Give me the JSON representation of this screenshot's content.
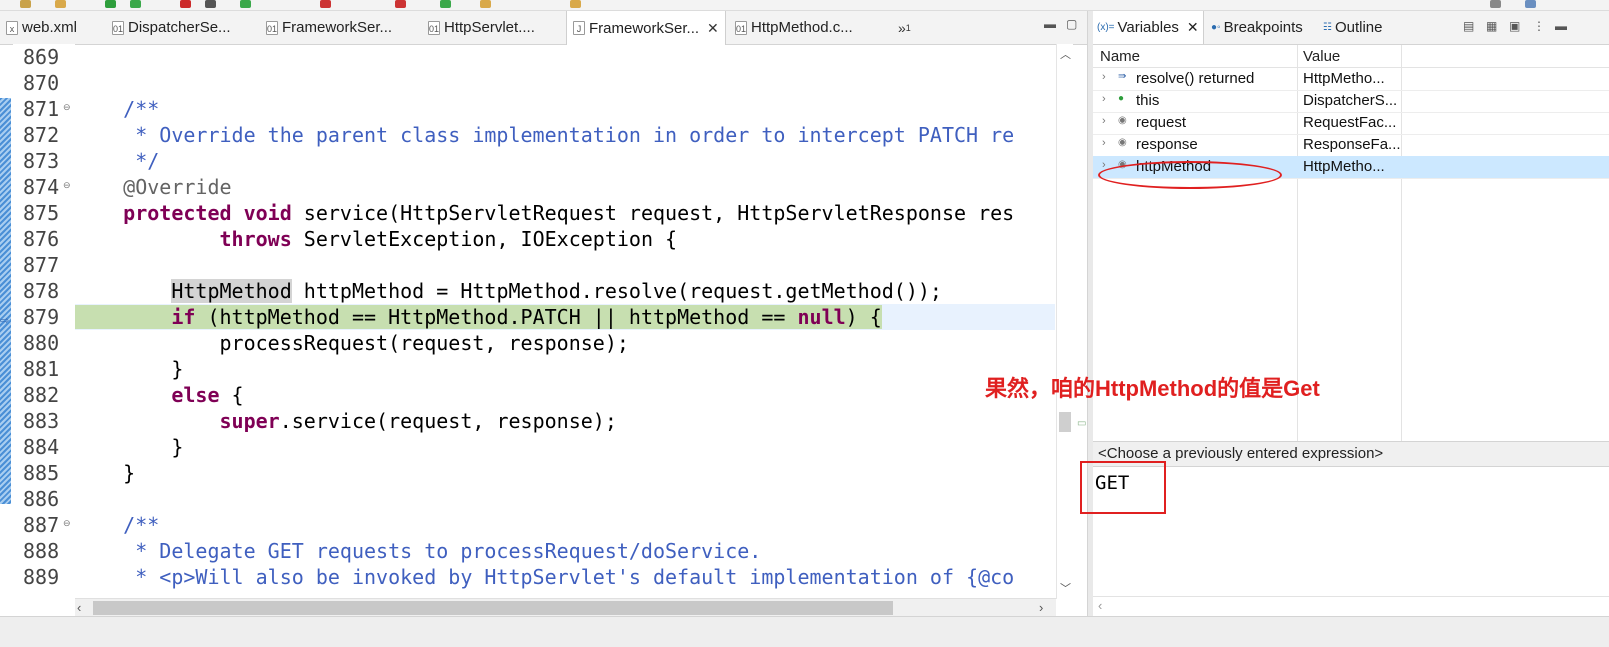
{
  "editor_tabs": [
    {
      "label": "web.xml",
      "icon": "xml-file-icon",
      "active": false
    },
    {
      "label": "DispatcherSe...",
      "icon": "class-file-icon",
      "active": false
    },
    {
      "label": "FrameworkSer...",
      "icon": "class-file-icon",
      "active": false
    },
    {
      "label": "HttpServlet....",
      "icon": "class-file-icon",
      "active": false
    },
    {
      "label": "FrameworkSer...",
      "icon": "java-file-icon",
      "active": true
    },
    {
      "label": "HttpMethod.c...",
      "icon": "class-file-icon",
      "active": false
    }
  ],
  "tab_overflow": {
    "symbol": "»",
    "count": "1"
  },
  "code_lines": [
    {
      "n": "869"
    },
    {
      "n": "870"
    },
    {
      "n": "871"
    },
    {
      "n": "872"
    },
    {
      "n": "873"
    },
    {
      "n": "874"
    },
    {
      "n": "875"
    },
    {
      "n": "876"
    },
    {
      "n": "877"
    },
    {
      "n": "878"
    },
    {
      "n": "879"
    },
    {
      "n": "880"
    },
    {
      "n": "881"
    },
    {
      "n": "882"
    },
    {
      "n": "883"
    },
    {
      "n": "884"
    },
    {
      "n": "885"
    },
    {
      "n": "886"
    },
    {
      "n": "887"
    },
    {
      "n": "888"
    },
    {
      "n": "889"
    }
  ],
  "code": {
    "l871": "    /**",
    "l872": "     * Override the parent class implementation in order to intercept PATCH re",
    "l873": "     */",
    "l874": "    @Override",
    "l875_kw": "protected void",
    "l875_rest": " service(HttpServletRequest request, HttpServletResponse res",
    "l876_kw": "throws",
    "l876_rest": " ServletException, IOException {",
    "l878_type": "HttpMethod",
    "l878_rest": " httpMethod = HttpMethod.resolve(request.getMethod());",
    "l879_kw1": "if",
    "l879_mid": " (httpMethod == HttpMethod.PATCH || httpMethod == ",
    "l879_kw2": "null",
    "l879_end": ") {",
    "l880": "processRequest(request, response);",
    "l881": "}",
    "l882_kw": "else",
    "l882_rest": " {",
    "l883_kw": "super",
    "l883_rest": ".service(request, response);",
    "l884": "}",
    "l885": "}",
    "l887": "    /**",
    "l888": "     * Delegate GET requests to processRequest/doService.",
    "l889": "     * <p>Will also be invoked by HttpServlet's default implementation of {@co"
  },
  "panel_tabs": [
    {
      "label": "Variables",
      "icon": "variables-icon",
      "active": true
    },
    {
      "label": "Breakpoints",
      "icon": "breakpoints-icon",
      "active": false
    },
    {
      "label": "Outline",
      "icon": "outline-icon",
      "active": false
    }
  ],
  "variables": {
    "headers": {
      "name": "Name",
      "value": "Value"
    },
    "rows": [
      {
        "name": "resolve() returned",
        "value": "HttpMetho...",
        "icon": "return-value-icon",
        "selected": false
      },
      {
        "name": "this",
        "value": "DispatcherS...",
        "icon": "field-icon",
        "selected": false
      },
      {
        "name": "request",
        "value": "RequestFac...",
        "icon": "local-variable-icon",
        "selected": false
      },
      {
        "name": "response",
        "value": "ResponseFa...",
        "icon": "local-variable-icon",
        "selected": false
      },
      {
        "name": "httpMethod",
        "value": "HttpMetho...",
        "icon": "local-variable-icon",
        "selected": true
      }
    ]
  },
  "expression_prompt": "<Choose a previously entered expression>",
  "detail_value": "GET",
  "annotation_text": "果然，咱的HttpMethod的值是Get",
  "colors": {
    "keyword": "#7f0055",
    "comment": "#3f5fbf",
    "annotation_red": "#e02020",
    "debug_line": "#c7dfb0",
    "selection": "#cce8ff"
  }
}
